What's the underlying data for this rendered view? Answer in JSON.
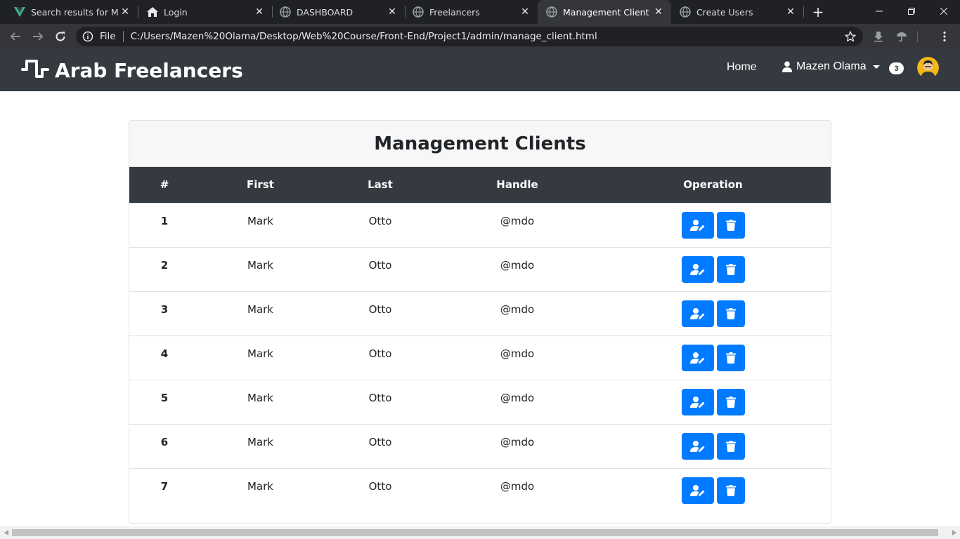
{
  "browser": {
    "tabs": [
      {
        "title": "Search results for Mana",
        "icon": "vue-logo-icon",
        "active": false
      },
      {
        "title": "Login",
        "icon": "home-icon",
        "active": false
      },
      {
        "title": "DASHBOARD",
        "icon": "globe-icon",
        "active": false
      },
      {
        "title": "Freelancers",
        "icon": "globe-icon",
        "active": false
      },
      {
        "title": "Management Client",
        "icon": "globe-icon",
        "active": true
      },
      {
        "title": "Create Users",
        "icon": "globe-icon",
        "active": false
      }
    ],
    "omnibox": {
      "scheme_label": "File",
      "url": "C:/Users/Mazen%20Olama/Desktop/Web%20Course/Front-End/Project1/admin/manage_client.html"
    }
  },
  "navbar": {
    "brand": "Arab Freelancers",
    "home_label": "Home",
    "user_name": "Mazen Olama",
    "notification_count": "3"
  },
  "card": {
    "title": "Management Clients"
  },
  "table": {
    "headers": [
      "#",
      "First",
      "Last",
      "Handle",
      "Operation"
    ],
    "rows": [
      {
        "index": "1",
        "first": "Mark",
        "last": "Otto",
        "handle": "@mdo"
      },
      {
        "index": "2",
        "first": "Mark",
        "last": "Otto",
        "handle": "@mdo"
      },
      {
        "index": "3",
        "first": "Mark",
        "last": "Otto",
        "handle": "@mdo"
      },
      {
        "index": "4",
        "first": "Mark",
        "last": "Otto",
        "handle": "@mdo"
      },
      {
        "index": "5",
        "first": "Mark",
        "last": "Otto",
        "handle": "@mdo"
      },
      {
        "index": "6",
        "first": "Mark",
        "last": "Otto",
        "handle": "@mdo"
      },
      {
        "index": "7",
        "first": "Mark",
        "last": "Otto",
        "handle": "@mdo"
      }
    ]
  },
  "colors": {
    "navbar_bg": "#343a40",
    "primary": "#007bff",
    "chrome_dark": "#202124",
    "chrome_toolbar": "#35363a"
  }
}
